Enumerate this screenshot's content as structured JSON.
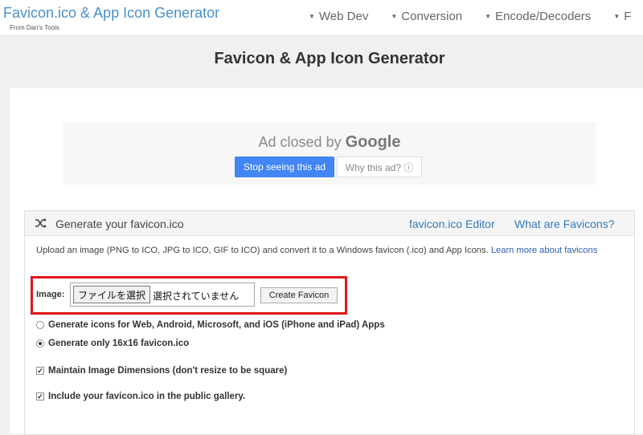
{
  "header": {
    "brand_title": "Favicon.ico & App Icon Generator",
    "brand_sub": "From Dan's Tools",
    "nav": [
      {
        "label": "Web Dev"
      },
      {
        "label": "Conversion"
      },
      {
        "label": "Encode/Decoders"
      },
      {
        "label": "F"
      }
    ]
  },
  "page_title": "Favicon & App Icon Generator",
  "ad": {
    "closed_prefix": "Ad closed by",
    "closed_brand": "Google",
    "stop_button": "Stop seeing this ad",
    "why_button": "Why this ad? ⓘ"
  },
  "card": {
    "title": "Generate your favicon.ico",
    "link_editor": "favicon.ico Editor",
    "link_what": "What are Favicons?",
    "description": "Upload an image (PNG to ICO, JPG to ICO, GIF to ICO) and convert it to a Windows favicon (.ico) and App Icons.",
    "learn_more": "Learn more about favicons"
  },
  "form": {
    "image_label": "Image:",
    "file_button": "ファイルを選択",
    "file_status": "選択されていません",
    "create_button": "Create Favicon",
    "options": [
      {
        "label": "Generate icons for Web, Android, Microsoft, and iOS (iPhone and iPad) Apps",
        "checked": false
      },
      {
        "label": "Generate only 16x16 favicon.ico",
        "checked": true
      }
    ],
    "checkboxes": [
      {
        "label": "Maintain Image Dimensions (don't resize to be square)",
        "checked": true
      },
      {
        "label": "Include your favicon.ico in the public gallery.",
        "checked": true
      }
    ]
  },
  "colors": {
    "accent_link": "#337ab7",
    "brand": "#4a90c8",
    "ad_blue": "#4285f4",
    "highlight_red": "#e0161b"
  }
}
